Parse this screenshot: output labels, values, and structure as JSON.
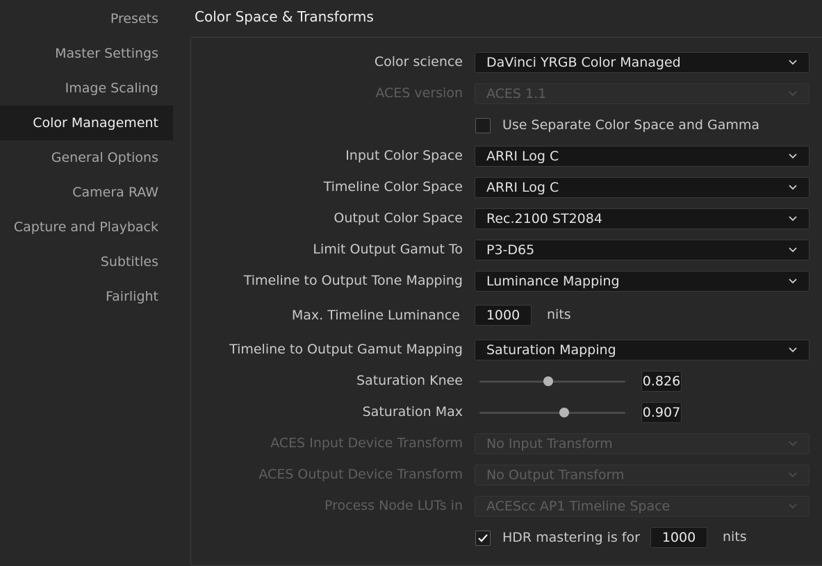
{
  "sidebar": {
    "items": [
      {
        "label": "Presets"
      },
      {
        "label": "Master Settings"
      },
      {
        "label": "Image Scaling"
      },
      {
        "label": "Color Management",
        "active": true
      },
      {
        "label": "General Options"
      },
      {
        "label": "Camera RAW"
      },
      {
        "label": "Capture and Playback"
      },
      {
        "label": "Subtitles"
      },
      {
        "label": "Fairlight"
      }
    ]
  },
  "section": {
    "title": "Color Space & Transforms"
  },
  "fields": {
    "color_science": {
      "label": "Color science",
      "value": "DaVinci YRGB Color Managed"
    },
    "aces_version": {
      "label": "ACES version",
      "value": "ACES 1.1"
    },
    "separate_cs": {
      "label": "Use Separate Color Space and Gamma",
      "checked": false
    },
    "input_cs": {
      "label": "Input Color Space",
      "value": "ARRI Log C"
    },
    "timeline_cs": {
      "label": "Timeline Color Space",
      "value": "ARRI Log C"
    },
    "output_cs": {
      "label": "Output Color Space",
      "value": "Rec.2100 ST2084"
    },
    "limit_gamut": {
      "label": "Limit Output Gamut To",
      "value": "P3-D65"
    },
    "tone_mapping": {
      "label": "Timeline to Output Tone Mapping",
      "value": "Luminance Mapping"
    },
    "max_luminance": {
      "label": "Max. Timeline Luminance",
      "value": "1000",
      "unit": "nits"
    },
    "gamut_mapping": {
      "label": "Timeline to Output Gamut Mapping",
      "value": "Saturation Mapping"
    },
    "sat_knee": {
      "label": "Saturation Knee",
      "value": "0.826",
      "slider_fraction": 0.47
    },
    "sat_max": {
      "label": "Saturation Max",
      "value": "0.907",
      "slider_fraction": 0.58
    },
    "aces_idt": {
      "label": "ACES Input Device Transform",
      "value": "No Input Transform"
    },
    "aces_odt": {
      "label": "ACES Output Device Transform",
      "value": "No Output Transform"
    },
    "process_luts": {
      "label": "Process Node LUTs in",
      "value": "ACEScc AP1 Timeline Space"
    },
    "hdr_mastering": {
      "label": "HDR mastering is for",
      "checked": true,
      "value": "1000",
      "unit": "nits"
    }
  },
  "colors": {
    "background": "#282828",
    "active_item": "#1c1c1c",
    "field_bg": "#161616",
    "disabled_text": "#5f5f5f"
  }
}
